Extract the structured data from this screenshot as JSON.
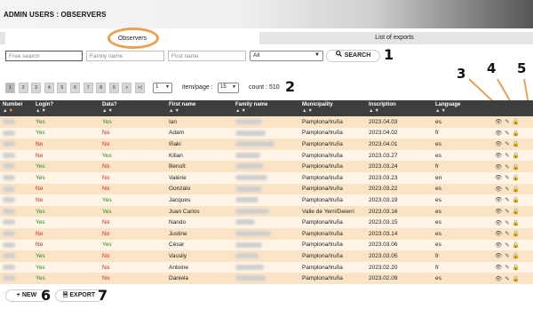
{
  "app": {
    "title": "ADMIN USERS : OBSERVERS"
  },
  "tabs": {
    "observers": "Observers",
    "exports": "List of exports"
  },
  "filters": {
    "free_search_placeholder": "Free search",
    "family_name_placeholder": "Family name",
    "first_name_placeholder": "First name",
    "select_value": "All",
    "search_label": "SEARCH"
  },
  "callouts": [
    "1",
    "2",
    "3",
    "4",
    "5",
    "6",
    "7"
  ],
  "pager": {
    "pages": [
      "1",
      "2",
      "3",
      "4",
      "5",
      "6",
      "7",
      "8",
      "9",
      ">",
      ">|"
    ],
    "page_select": "1",
    "items_per_page_label": "item/page :",
    "items_per_page_value": "15",
    "count_text": "count : 510"
  },
  "table": {
    "columns": [
      "Number",
      "Login?",
      "Data?",
      "First name",
      "Family name",
      "Municipality",
      "Inscription",
      "Language"
    ],
    "rows": [
      {
        "login": "Yes",
        "data": "Yes",
        "first": "Ian",
        "muni": "Pamplona/Iruña",
        "date": "2023.04.03",
        "lang": "es"
      },
      {
        "login": "Yes",
        "data": "No",
        "first": "Adam",
        "muni": "Pamplona/Iruña",
        "date": "2023.04.02",
        "lang": "fr"
      },
      {
        "login": "No",
        "data": "No",
        "first": "Iñaki",
        "muni": "Pamplona/Iruña",
        "date": "2023.04.01",
        "lang": "es"
      },
      {
        "login": "No",
        "data": "Yes",
        "first": "Kilian",
        "muni": "Pamplona/Iruña",
        "date": "2023.03.27",
        "lang": "es"
      },
      {
        "login": "Yes",
        "data": "No",
        "first": "Benoît",
        "muni": "Pamplona/Iruña",
        "date": "2023.03.24",
        "lang": "fr"
      },
      {
        "login": "Yes",
        "data": "No",
        "first": "Valérie",
        "muni": "Pamplona/Iruña",
        "date": "2023.03.23",
        "lang": "en"
      },
      {
        "login": "No",
        "data": "No",
        "first": "Gonzalo",
        "muni": "Pamplona/Iruña",
        "date": "2023.03.22",
        "lang": "es"
      },
      {
        "login": "No",
        "data": "Yes",
        "first": "Jacques",
        "muni": "Pamplona/Iruña",
        "date": "2023.03.19",
        "lang": "es"
      },
      {
        "login": "Yes",
        "data": "Yes",
        "first": "Juan Carlos",
        "muni": "Valle de Yerri/Deierri",
        "date": "2023.03.16",
        "lang": "es"
      },
      {
        "login": "Yes",
        "data": "No",
        "first": "Nando",
        "muni": "Pamplona/Iruña",
        "date": "2023.03.15",
        "lang": "es"
      },
      {
        "login": "No",
        "data": "No",
        "first": "Justine",
        "muni": "Pamplona/Iruña",
        "date": "2023.03.14",
        "lang": "es"
      },
      {
        "login": "No",
        "data": "Yes",
        "first": "César",
        "muni": "Pamplona/Iruña",
        "date": "2023.03.06",
        "lang": "es"
      },
      {
        "login": "Yes",
        "data": "No",
        "first": "Vassily",
        "muni": "Pamplona/Iruña",
        "date": "2023.03.05",
        "lang": "fr"
      },
      {
        "login": "Yes",
        "data": "No",
        "first": "Antoine",
        "muni": "Pamplona/Iruña",
        "date": "2023.02.20",
        "lang": "fr"
      },
      {
        "login": "Yes",
        "data": "No",
        "first": "Daniela",
        "muni": "Pamplona/Iruña",
        "date": "2023.02.09",
        "lang": "es"
      }
    ]
  },
  "actions": {
    "new_label": "NEW",
    "export_label": "EXPORT"
  },
  "icons": {
    "view": "eye-icon",
    "edit": "pencil-icon",
    "lock": "lock-icon",
    "search": "search-icon",
    "add": "plus-icon",
    "export": "document-icon"
  },
  "colors": {
    "header_bg": "#3e3e3e",
    "row_odd": "#fbe3c6",
    "row_even": "#fff4e6",
    "yes": "#1f8a1f",
    "no": "#d0241c",
    "highlight": "#e8a14e"
  }
}
